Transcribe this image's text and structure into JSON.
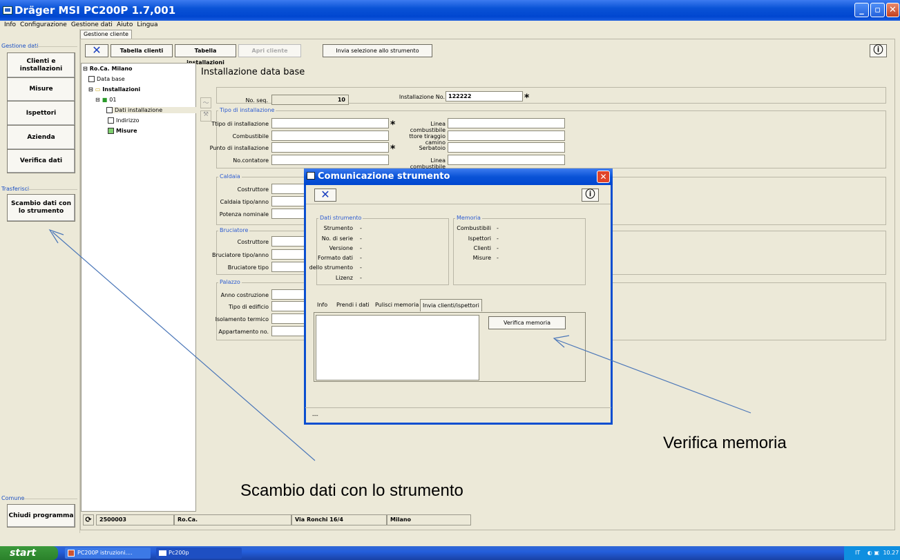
{
  "window": {
    "title": "Dräger MSI PC200P 1.7,001"
  },
  "menu": [
    "Info",
    "Configurazione",
    "Gestione dati",
    "Aiuto",
    "Lingua"
  ],
  "tab_label": "Gestione cliente",
  "sidebar": {
    "group_gestione": "Gestione dati",
    "btn_clienti": "Clienti e installazioni",
    "btn_misure": "Misure",
    "btn_ispettori": "Ispettori",
    "btn_azienda": "Azienda",
    "btn_verifica": "Verifica dati",
    "group_trasferisci": "Trasferisci",
    "btn_scambio": "Scambio dati con lo strumento",
    "group_comune": "Comune",
    "btn_chiudi": "Chiudi programma"
  },
  "toolbar": {
    "close_glyph": "✕",
    "tabella_clienti": "Tabella clienti",
    "tabella_installazioni": "Tabella installazioni",
    "apri_cliente": "Apri cliente",
    "invia_selezione": "Invia selezione allo strumento"
  },
  "tree": {
    "root": "Ro.Ca. Milano",
    "data_base": "Data base",
    "installazioni": "Installazioni",
    "inst01": "01",
    "dati_installazione": "Dati installazione",
    "indirizzo": "Indirizzo",
    "misure": "Misure"
  },
  "form": {
    "heading": "Installazione data base",
    "no_seq_label": "No. seq.",
    "no_seq_value": "10",
    "inst_no_label": "Installazione No.",
    "inst_no_value": "122222",
    "sect_tipo": "Tipo di installazione",
    "tipo_inst": "Ttipo di installazione",
    "combustibile": "Combustibile",
    "punto_inst": "Punto di installazione",
    "no_contatore": "No.contatore",
    "linea_comb1": "Linea combustibile",
    "tiraggio": "ttore tiraggio camino",
    "serbatoio": "Serbatoio",
    "linea_comb2": "Linea combustibile",
    "sect_caldaia": "Caldaia",
    "costruttore": "Costruttore",
    "caldaia_tipo": "Caldaia tipo/anno",
    "potenza": "Potenza nominale",
    "sect_bruciatore": "Bruciatore",
    "b_costruttore": "Costruttore",
    "bruc_tipo_anno": "Bruciatore tipo/anno",
    "bruc_tipo": "Bruciatore tipo",
    "sect_palazzo": "Palazzo",
    "anno_costr": "Anno costruzione",
    "tipo_edificio": "Tipo di edificio",
    "isolamento": "Isolamento termico",
    "appartamento": "Appartamento no."
  },
  "dialog": {
    "title": "Comunicazione strumento",
    "sect_dati": "Dati strumento",
    "strumento": "Strumento",
    "no_serie": "No. di serie",
    "versione": "Versione",
    "formato": "Formato dati",
    "modello": "dello strumento",
    "lizenz": "Lizenz",
    "sect_memoria": "Memoria",
    "combustibili": "Combustibili",
    "ispettori": "Ispettori",
    "clienti": "Clienti",
    "misure": "Misure",
    "dash": "-",
    "tabs": [
      "Info",
      "Prendi i dati",
      "Pulisci memoria",
      "Invia clienti/ispettori"
    ],
    "verifica_btn": "Verifica memoria",
    "status": "---"
  },
  "statusbar": {
    "code": "2500003",
    "name": "Ro.Ca.",
    "address": "Via Ronchi 16/4",
    "city": "Milano"
  },
  "annotations": {
    "verifica": "Verifica memoria",
    "scambio": "Scambio dati con lo strumento"
  },
  "taskbar": {
    "start": "start",
    "item1": "PC200P istruzioni....",
    "item2": "Pc200p",
    "lang": "IT",
    "time": "10.27"
  },
  "colors": {
    "title_blue": "#0a53d6",
    "section_blue": "#2c5bd1",
    "close_red": "#e0442a"
  }
}
